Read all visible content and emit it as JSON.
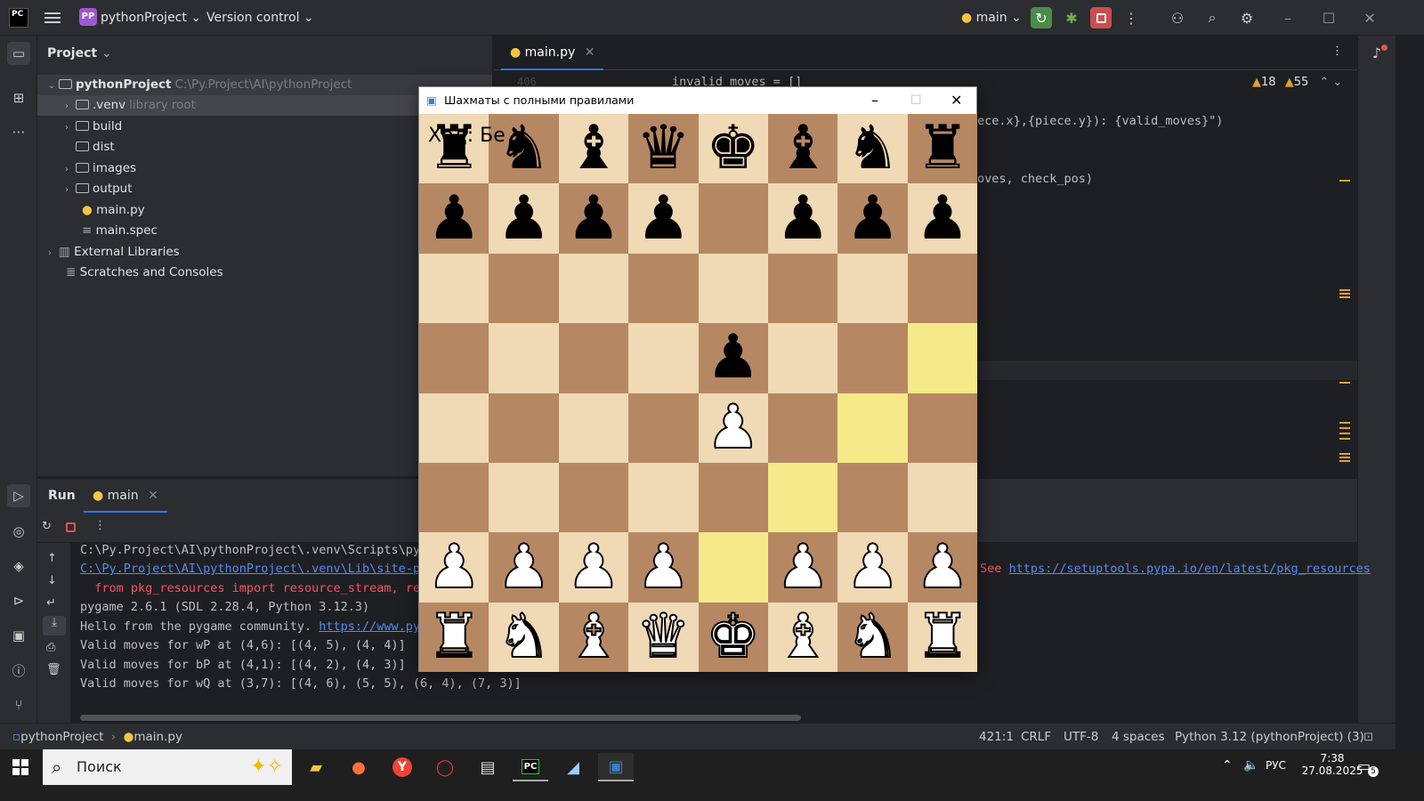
{
  "titlebar": {
    "logo": "PC",
    "project_badge": "PP",
    "project_name": "pythonProject",
    "vcs": "Version control",
    "run_config": "main"
  },
  "project_panel": {
    "title": "Project",
    "items": [
      {
        "label": "pythonProject",
        "hint": "C:\\Py.Project\\AI\\pythonProject"
      },
      {
        "label": ".venv",
        "hint": "library root"
      },
      {
        "label": "build",
        "hint": ""
      },
      {
        "label": "dist",
        "hint": ""
      },
      {
        "label": "images",
        "hint": ""
      },
      {
        "label": "output",
        "hint": ""
      },
      {
        "label": "main.py",
        "hint": ""
      },
      {
        "label": "main.spec",
        "hint": ""
      },
      {
        "label": "External Libraries",
        "hint": ""
      },
      {
        "label": "Scratches and Consoles",
        "hint": ""
      }
    ]
  },
  "editor": {
    "tab": "main.py",
    "line_number": "406",
    "warnings": "18",
    "weak_warnings": "55",
    "code_lines": [
      "invalid_moves = []",
      "ece.x},{piece.y}): {valid_moves}\")",
      "oves, check_pos)"
    ]
  },
  "run_panel": {
    "tab_run": "Run",
    "tab_main": "main",
    "lines": [
      {
        "text": "C:\\Py.Project\\AI\\pythonProject\\.venv\\Scripts\\pyth",
        "kind": "plain"
      },
      {
        "text": "C:\\Py.Project\\AI\\pythonProject\\.venv\\Lib\\site-pac",
        "kind": "link"
      },
      {
        "text": "  from pkg_resources import resource_stream, reso",
        "kind": "err"
      },
      {
        "text": "pygame 2.6.1 (SDL 2.28.4, Python 3.12.3)",
        "kind": "plain"
      },
      {
        "text": "Hello from the pygame community. ",
        "kind": "plain"
      },
      {
        "text": "Valid moves for wP at (4,6): [(4, 5), (4, 4)]",
        "kind": "plain"
      },
      {
        "text": "Valid moves for bP at (4,1): [(4, 2), (4, 3)]",
        "kind": "plain"
      },
      {
        "text": "Valid moves for wQ at (3,7): [(4, 6), (5, 5), (6, 4), (7, 3)]",
        "kind": "plain"
      }
    ],
    "community_link": "https://www.pyga",
    "see_label": "See ",
    "see_link": "https://setuptools.pypa.io/en/latest/pkg_resources"
  },
  "statusbar": {
    "crumb_project": "pythonProject",
    "crumb_file": "main.py",
    "position": "421:1",
    "line_sep": "CRLF",
    "encoding": "UTF-8",
    "indent": "4 spaces",
    "interpreter": "Python 3.12 (pythonProject) (3)"
  },
  "taskbar": {
    "search_placeholder": "Поиск",
    "lang": "РУС",
    "time": "7:38",
    "date": "27.08.2025",
    "notif_count": "5"
  },
  "pygame": {
    "title": "Шахматы с полными правилами",
    "turn_text": "Ход: Бе",
    "board": [
      [
        "bR",
        "bN",
        "bB",
        "bQ",
        "bK",
        "bB",
        "bN",
        "bR"
      ],
      [
        "bP",
        "bP",
        "bP",
        "bP",
        "",
        "bP",
        "bP",
        "bP"
      ],
      [
        "",
        "",
        "",
        "",
        "",
        "",
        "",
        ""
      ],
      [
        "",
        "",
        "",
        "",
        "bP",
        "",
        "",
        ""
      ],
      [
        "",
        "",
        "",
        "",
        "wP",
        "",
        "",
        ""
      ],
      [
        "",
        "",
        "",
        "",
        "",
        "",
        "",
        ""
      ],
      [
        "wP",
        "wP",
        "wP",
        "wP",
        "",
        "wP",
        "wP",
        "wP"
      ],
      [
        "wR",
        "wN",
        "wB",
        "wQ",
        "wK",
        "wB",
        "wN",
        "wR"
      ]
    ],
    "highlights": [
      [
        7,
        3
      ],
      [
        6,
        4
      ],
      [
        5,
        5
      ],
      [
        4,
        6
      ]
    ]
  },
  "colors": {
    "light_square": "#f0d9b5",
    "dark_square": "#b58863",
    "highlight": "#f5e98a",
    "accent": "#3574f0"
  }
}
